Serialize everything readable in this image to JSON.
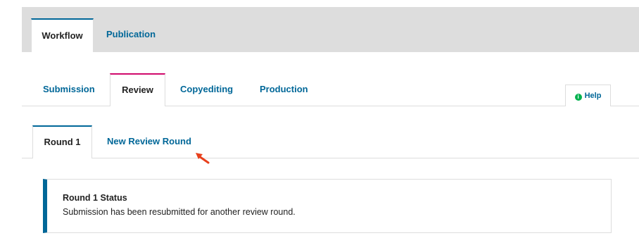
{
  "top_tabs": {
    "workflow": "Workflow",
    "publication": "Publication"
  },
  "stage_tabs": {
    "submission": "Submission",
    "review": "Review",
    "copyediting": "Copyediting",
    "production": "Production"
  },
  "help": {
    "icon_glyph": "i",
    "label": "Help"
  },
  "round_tabs": {
    "round1": "Round 1",
    "new_round": "New Review Round"
  },
  "status": {
    "title": "Round 1 Status",
    "message": "Submission has been resubmitted for another review round."
  },
  "colors": {
    "link": "#006798",
    "active_stage_border": "#d00a6c",
    "annotation_arrow": "#e8401c",
    "help_icon": "#00b24e"
  }
}
